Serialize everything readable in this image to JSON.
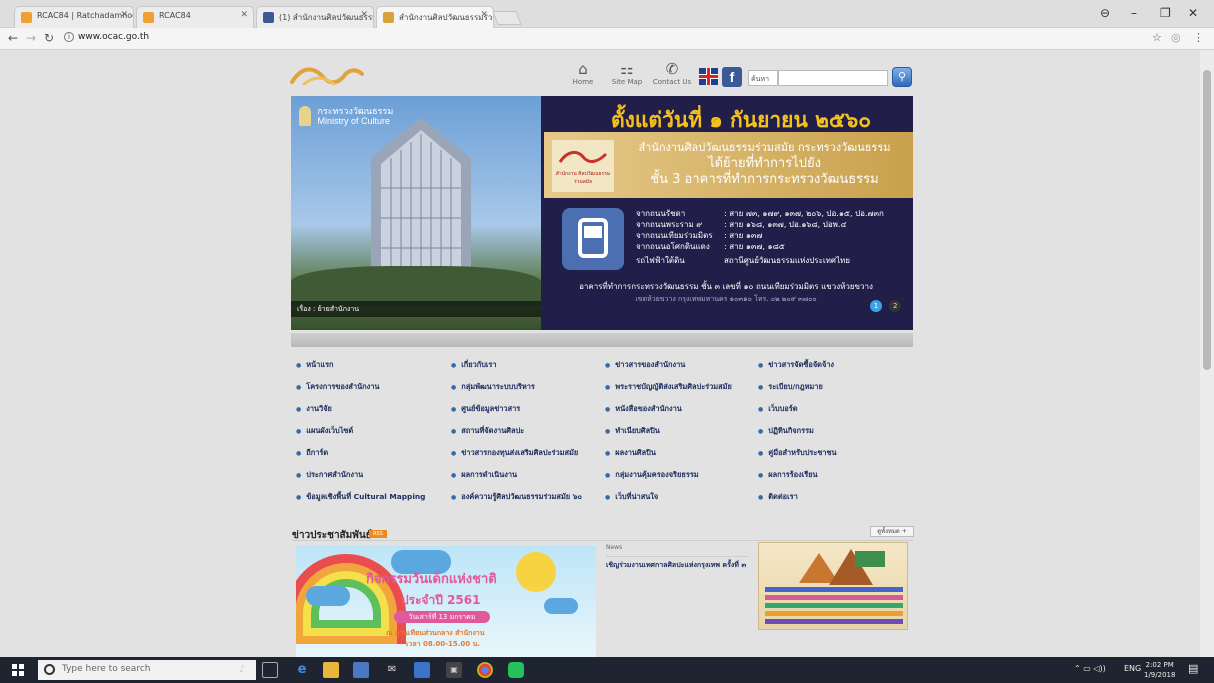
{
  "browser": {
    "tabs": [
      {
        "label": "RCAC84 | Ratchadamnoe",
        "active": false
      },
      {
        "label": "RCAC84",
        "active": false
      },
      {
        "label": "(1) สำนักงานศิลปวัฒนธรรม",
        "active": false
      },
      {
        "label": "สำนักงานศิลปวัฒนธรรมร่วม",
        "active": true
      }
    ],
    "url": "www.ocac.go.th",
    "window_controls": {
      "user": "⊖",
      "minimize": "–",
      "maximize": "❐",
      "close": "✕"
    }
  },
  "site": {
    "topnav": [
      {
        "label": "Home",
        "icon": "home-icon",
        "glyph": "⌂"
      },
      {
        "label": "Site Map",
        "icon": "sitemap-icon",
        "glyph": "⚏"
      },
      {
        "label": "Contact Us",
        "icon": "phone-icon",
        "glyph": "✆"
      }
    ],
    "search": {
      "label": "ค้นหา",
      "placeholder": ""
    },
    "facebook_letter": "f"
  },
  "banner": {
    "ministry_th": "กระทรวงวัฒนธรรม",
    "ministry_en": "Ministry of Culture",
    "photo_caption": "เรื่อง : ย้ายสำนักงาน",
    "headline": "ตั้งแต่วันที่ ๑ กันยายน ๒๕๖๐",
    "strip_line1": "สำนักงานศิลปวัฒนธรรมร่วมสมัย กระทรวงวัฒนธรรม",
    "strip_line2": "ได้ย้ายที่ทำการไปยัง",
    "strip_line3": "ชั้น 3 อาคารที่ทำการกระทรวงวัฒนธรรม",
    "strip_logo_text": "สำนักงาน ศิลปวัฒนธรรม ร่วมสมัย",
    "routes": [
      {
        "from": "จากถนนรัชดา",
        "lines": ": สาย ๗๓, ๑๗๙, ๑๓๗, ๒๐๖, ปอ.๑๕, ปอ.๗๓ก"
      },
      {
        "from": "จากถนนพระราม ๙",
        "lines": ": สาย ๑๖๘, ๑๓๗, ปอ.๑๖๘, ปอพ.๔"
      },
      {
        "from": "จากถนนเทียมร่วมมิตร",
        "lines": ": สาย ๑๓๗"
      },
      {
        "from": "จากถนนอโศกดินแดง",
        "lines": ": สาย ๑๓๗, ๑๘๕"
      },
      {
        "from": "รถไฟฟ้าใต้ดิน",
        "lines": "สถานีศูนย์วัฒนธรรมแห่งประเทศไทย"
      }
    ],
    "address": "อาคารที่ทำการกระทรวงวัฒนธรรม ชั้น ๓ เลขที่ ๑๐ ถนนเทียมร่วมมิตร แขวงห้วยขวาง",
    "address_sub": "เขตห้วยขวาง กรุงเทพมหานคร ๑๐๓๑๐ โทร. ๐๒ ๒๐๙ ๓๗๐๐",
    "dots": [
      "1",
      "2"
    ]
  },
  "menu": [
    [
      "หน้าแรก",
      "เกี่ยวกับเรา",
      "ข่าวสารของสำนักงาน",
      "ข่าวสารจัดซื้อจัดจ้าง"
    ],
    [
      "โครงการของสำนักงาน",
      "กลุ่มพัฒนาระบบบริหาร",
      "พระราชบัญญัติส่งเสริมศิลปะร่วมสมัย",
      "ระเบียบ/กฎหมาย"
    ],
    [
      "งานวิจัย",
      "ศูนย์ข้อมูลข่าวสาร",
      "หนังสือของสำนักงาน",
      "เว็บบอร์ด"
    ],
    [
      "แผนผังเว็บไซต์",
      "สถานที่จัดงานศิลปะ",
      "ทำเนียบศิลปิน",
      "ปฏิทินกิจกรรม"
    ],
    [
      "ถีการ์ด",
      "ข่าวสารกองทุนส่งเสริมศิลปะร่วมสมัย",
      "ผลงานศิลปิน",
      "คู่มือสำหรับประชาชน"
    ],
    [
      "ประกาศสำนักงาน",
      "ผลการดำเนินงาน",
      "กลุ่มงานคุ้มครองจริยธรรม",
      "ผลการร้องเรียน"
    ],
    [
      "ข้อมูลเชิงพื้นที่ Cultural Mapping",
      "องค์ความรู้ศิลปวัฒนธรรมร่วมสมัย ๖๐",
      "เว็บที่น่าสนใจ",
      "ติดต่อเรา"
    ]
  ],
  "news": {
    "heading": "ข่าวประชาสัมพันธ์",
    "rss_label": "RSS",
    "more_label": "ดูทั้งหมด +",
    "card1": {
      "title1": "กิจกรรมวันเด็กแห่งชาติ",
      "title2": "ประจำปี 2561",
      "pill": "วันเสาร์ที่ 13 มกราคม",
      "place": "ณ ลานเทียนส่วนกลาง สำนักงาน",
      "time": "เวลา 08.00-15.00 น."
    },
    "meta": "News",
    "item_title": "เชิญร่วมงานเทศกาลศิลปะแห่งกรุงเทพ ครั้งที่ ๓"
  },
  "taskbar": {
    "search_placeholder": "Type here to search",
    "tray_lang": "ENG",
    "time": "2:02 PM",
    "date": "1/9/2018"
  },
  "colors": {
    "banner_bg": "#221e4a",
    "headline": "#f6c21a",
    "menu_text": "#1f3060",
    "taskbar": "#1f2530"
  }
}
